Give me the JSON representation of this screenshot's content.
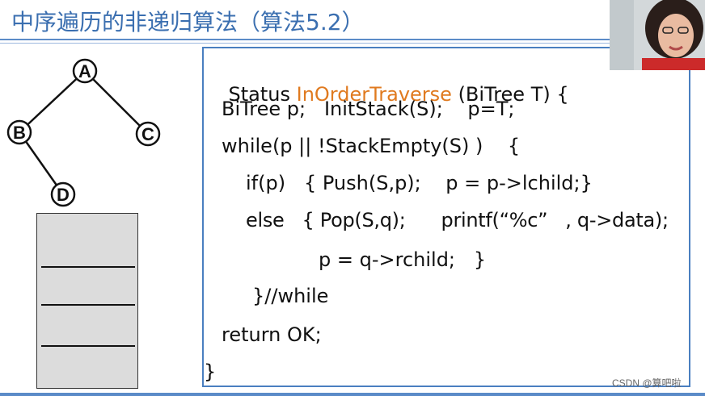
{
  "title": "中序遍历的非递归算法（算法5.2）",
  "tree": {
    "nodes": [
      "A",
      "B",
      "C",
      "D"
    ]
  },
  "code": {
    "line1_prefix": "Status ",
    "function_name": "InOrderTraverse",
    "line1_suffix": " (BiTree T) {",
    "line2": "BiTree p;   InitStack(S);    p=T;",
    "line3": "while(p || !StackEmpty(S) )    {",
    "line4": "if(p)   { Push(S,p);    p = p->lchild;}",
    "line5": "else   { Pop(S,q);      printf(“%c”   , q->data);",
    "line6": "p = q->rchild;   }",
    "line7": "}//while",
    "line8": "return OK;",
    "line9": "}"
  },
  "watermark": "CSDN @算吧啦",
  "colors": {
    "title": "#3b6fb0",
    "function_name": "#e07a1f",
    "panel_border": "#4a7fc0",
    "stack_fill": "#dcdcdc"
  }
}
